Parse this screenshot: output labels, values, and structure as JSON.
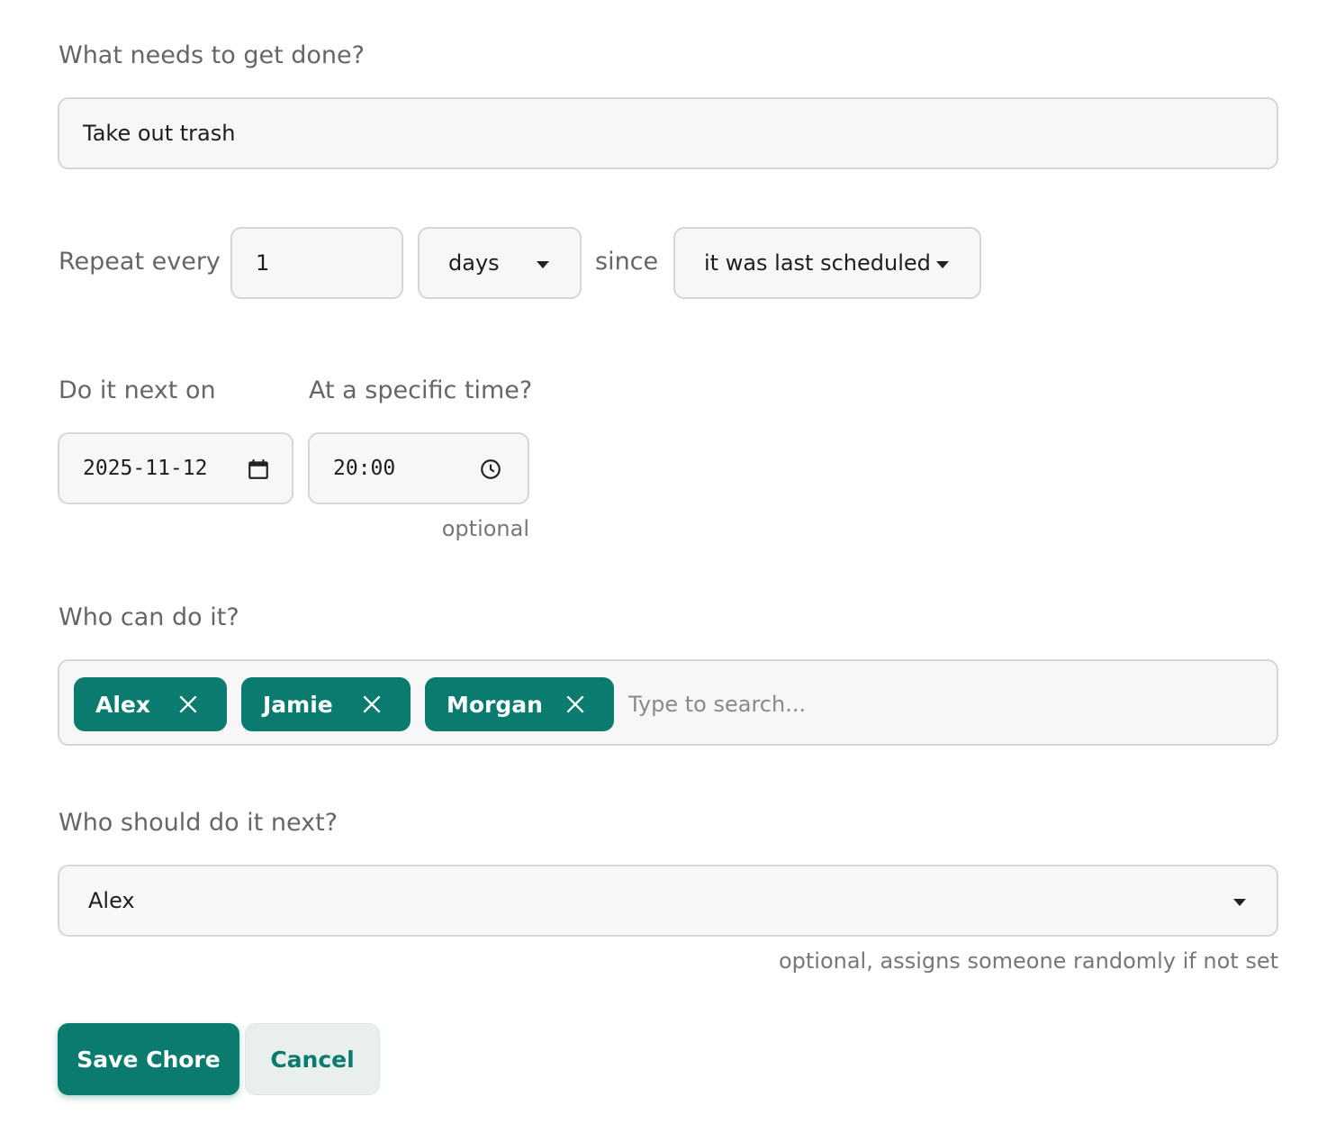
{
  "task": {
    "label": "What needs to get done?",
    "value": "Take out trash"
  },
  "repeat": {
    "label": "Repeat every",
    "interval_value": "1",
    "unit_selected": "days",
    "since_label": "since",
    "since_selected": "it was last scheduled"
  },
  "next_date": {
    "label": "Do it next on",
    "value": "2025-11-12"
  },
  "time": {
    "label": "At a specific time?",
    "value": "20:00",
    "hint": "optional"
  },
  "assignees": {
    "label": "Who can do it?",
    "chips": [
      "Alex",
      "Jamie",
      "Morgan"
    ],
    "placeholder": "Type to search..."
  },
  "next_assignee": {
    "label": "Who should do it next?",
    "selected": "Alex",
    "hint": "optional, assigns someone randomly if not set"
  },
  "actions": {
    "save_label": "Save Chore",
    "cancel_label": "Cancel"
  },
  "colors": {
    "primary": "#0a7b6e",
    "input_bg": "#f7f7f7",
    "border": "#d6d6d6",
    "cancel_bg": "#e8efed"
  }
}
